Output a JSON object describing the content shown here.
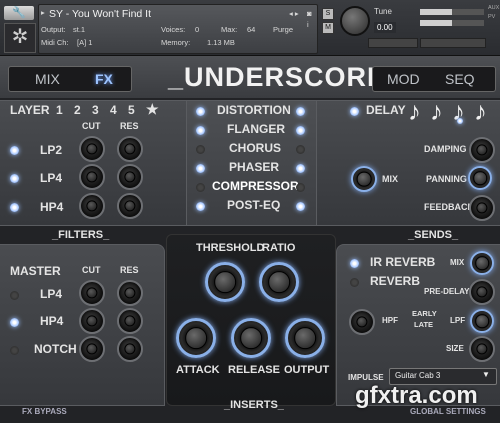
{
  "header": {
    "instrument_name": "SY - You Won't Find It",
    "output_label": "Output:",
    "output_value": "st.1",
    "midi_label": "Midi Ch:",
    "midi_value": "[A] 1",
    "voices_label": "Voices:",
    "voices_value": "0",
    "max_label": "Max:",
    "max_value": "64",
    "purge_label": "Purge",
    "memory_label": "Memory:",
    "memory_value": "1.13 MB",
    "tune_label": "Tune",
    "tune_value": "0.00",
    "solo": "S",
    "mute": "M",
    "side_labels": [
      "AUX",
      "PV"
    ]
  },
  "top": {
    "mix_tab": "MIX",
    "fx_tab": "FX",
    "title": "_UNDERSCORE_",
    "mod_tab": "MOD",
    "seq_tab": "SEQ"
  },
  "layer": {
    "label": "LAYER",
    "numbers": [
      "1",
      "2",
      "3",
      "4",
      "5"
    ],
    "star": "★",
    "cut_label": "CUT",
    "res_label": "RES",
    "filters": [
      "LP2",
      "LP4",
      "HP4"
    ],
    "section_label": "_FILTERS_"
  },
  "effects": {
    "items": [
      "DISTORTION",
      "FLANGER",
      "CHORUS",
      "PHASER",
      "COMPRESSOR",
      "POST-EQ"
    ]
  },
  "delay": {
    "label": "DELAY",
    "notes": [
      "♪",
      "♪",
      "♪",
      "♪"
    ],
    "damping": "DAMPING",
    "panning": "PANNING",
    "feedback": "FEEDBACK",
    "mix": "MIX",
    "section_label": "_SENDS_"
  },
  "master": {
    "label": "MASTER",
    "cut_label": "CUT",
    "res_label": "RES",
    "filters": [
      "LP4",
      "HP4",
      "NOTCH"
    ],
    "fx_bypass": "FX BYPASS"
  },
  "compressor": {
    "threshold": "THRESHOLD",
    "ratio": "RATIO",
    "attack": "ATTACK",
    "release": "RELEASE",
    "output": "OUTPUT",
    "section_label": "_INSERTS_"
  },
  "reverb": {
    "ir_reverb": "IR REVERB",
    "reverb": "REVERB",
    "mix": "MIX",
    "pre_delay": "PRE-DELAY",
    "hpf": "HPF",
    "early_late_1": "EARLY",
    "early_late_2": "LATE",
    "lpf": "LPF",
    "size": "SIZE",
    "impulse_label": "IMPULSE",
    "impulse_value": "Guitar Cab 3",
    "global_settings": "GLOBAL SETTINGS"
  },
  "watermark": "gfxtra.com"
}
